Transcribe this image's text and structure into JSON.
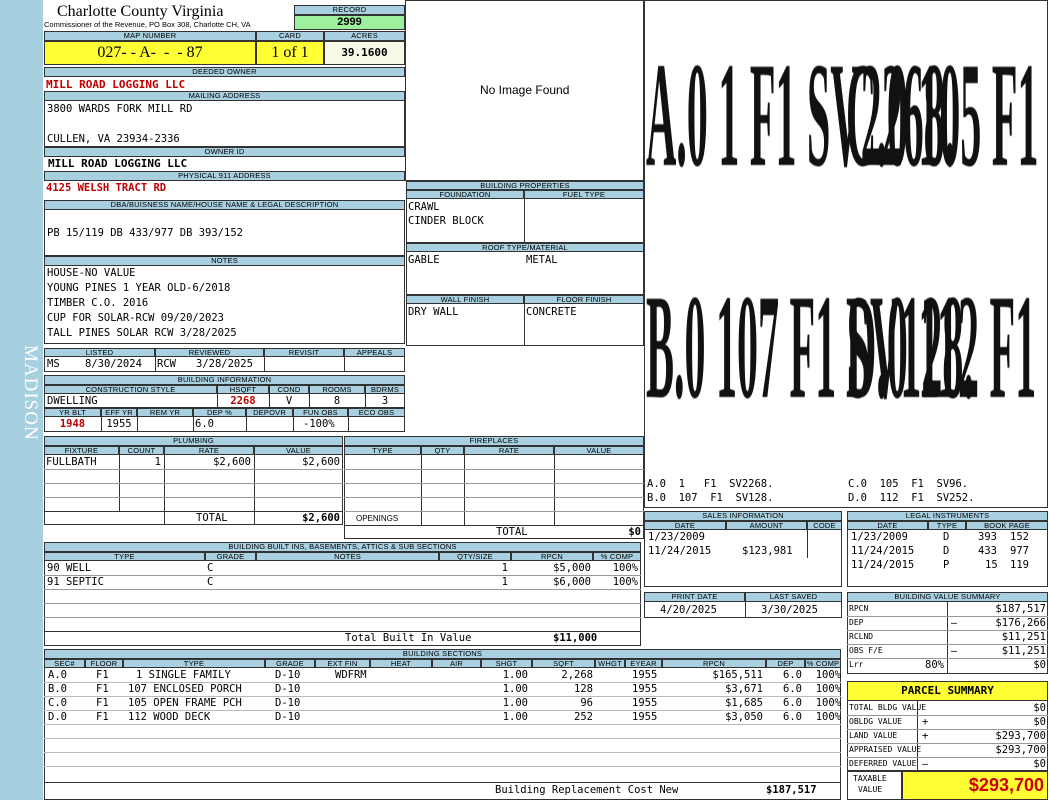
{
  "county": {
    "title": "Charlotte County Virginia",
    "subtitle": "Commissioner of the Revenue, PO Box 308, Charlotte CH, VA"
  },
  "side_label": "MADISON",
  "record": {
    "label": "RECORD",
    "value": "2999"
  },
  "map": {
    "label": "MAP NUMBER",
    "value": "027- - A-  -  - 87"
  },
  "card": {
    "label": "CARD",
    "value": "1 of 1"
  },
  "acres": {
    "label": "ACRES",
    "value": "39.1600"
  },
  "deeded_owner": {
    "label": "DEEDED OWNER",
    "value": "MILL ROAD LOGGING LLC"
  },
  "mailing": {
    "label": "MAILING ADDRESS",
    "line1": "3800 WARDS FORK MILL RD",
    "line2": "CULLEN, VA 23934-2336"
  },
  "owner_id": {
    "label": "OWNER ID",
    "value": "MILL ROAD LOGGING LLC"
  },
  "physical": {
    "label": "PHYSICAL 911 ADDRESS",
    "value": "4125 WELSH TRACT RD"
  },
  "dba": {
    "label": "DBA/BUISNESS NAME/HOUSE NAME & LEGAL DESCRIPTION",
    "value": "PB 15/119 DB 433/977 DB 393/152"
  },
  "notes": {
    "label": "NOTES",
    "lines": [
      "HOUSE-NO VALUE",
      "YOUNG PINES 1 YEAR OLD-6/2018",
      "TIMBER C.O. 2016",
      "CUP FOR SOLAR-RCW 09/20/2023",
      "TALL PINES SOLAR RCW 3/28/2025"
    ]
  },
  "review": {
    "listed_label": "LISTED",
    "reviewed_label": "REVIEWED",
    "revisit_label": "REVISIT",
    "appeals_label": "APPEALS",
    "listed_by": "MS",
    "listed_date": "8/30/2024",
    "reviewed_by": "RCW",
    "reviewed_date": "3/28/2025"
  },
  "building_info": {
    "label": "BUILDING INFORMATION",
    "construction_style_label": "CONSTRUCTION STYLE",
    "hsqft_label": "HSQFT",
    "cond_label": "COND",
    "rooms_label": "ROOMS",
    "bdrms_label": "BDRMS",
    "construction_style": "DWELLING",
    "hsqft": "2268",
    "cond": "V",
    "rooms": "8",
    "bdrms": "3",
    "yr_blt_label": "YR BLT",
    "eff_yr_label": "EFF YR",
    "rem_yr_label": "REM YR",
    "dep_pct_label": "DEP %",
    "depovr_label": "DEPOVR",
    "fun_obs_label": "FUN OBS",
    "eco_obs_label": "ECO OBS",
    "yr_blt": "1948",
    "eff_yr": "1955",
    "dep_pct": "6.0",
    "fun_obs": "-100%"
  },
  "no_image": "No Image Found",
  "bldg_props": {
    "label": "BUILDING PROPERTIES",
    "foundation_label": "FOUNDATION",
    "fuel_label": "FUEL TYPE",
    "foundation1": "CRAWL",
    "foundation2": "CINDER BLOCK",
    "roof_label": "ROOF TYPE/MATERIAL",
    "roof_type": "GABLE",
    "roof_material": "METAL",
    "wall_label": "WALL FINISH",
    "floor_label": "FLOOR FINISH",
    "wall": "DRY WALL",
    "floor": "CONCRETE"
  },
  "sketch": {
    "labels": [
      {
        "row": "A.0  1   F1  SV2268.",
        "right": "C.0  105  F1  SV96."
      },
      {
        "row": "B.0  107  F1  SV128.",
        "right": "D.0  112  F1  SV252."
      }
    ]
  },
  "plumbing": {
    "label": "PLUMBING",
    "headers": [
      "FIXTURE",
      "COUNT",
      "RATE",
      "VALUE"
    ],
    "rows": [
      {
        "fixture": "FULLBATH",
        "count": "1",
        "rate": "$2,600",
        "value": "$2,600"
      }
    ],
    "total_label": "TOTAL",
    "total": "$2,600"
  },
  "fireplaces": {
    "label": "FIREPLACES",
    "headers": [
      "TYPE",
      "QTY",
      "RATE",
      "VALUE"
    ],
    "openings_label": "OPENINGS",
    "total_label": "TOTAL",
    "total": "$0"
  },
  "sales": {
    "label": "SALES INFORMATION",
    "headers": [
      "DATE",
      "AMOUNT",
      "CODE"
    ],
    "rows": [
      {
        "date": "1/23/2009",
        "amount": "",
        "code": ""
      },
      {
        "date": "11/24/2015",
        "amount": "$123,981",
        "code": ""
      }
    ]
  },
  "legal": {
    "label": "LEGAL INSTRUMENTS",
    "headers": [
      "DATE",
      "TYPE",
      "BOOK PAGE"
    ],
    "rows": [
      {
        "date": "1/23/2009",
        "type": "D",
        "book": "393",
        "page": "152"
      },
      {
        "date": "11/24/2015",
        "type": "D",
        "book": "433",
        "page": "977"
      },
      {
        "date": "11/24/2015",
        "type": "P",
        "book": "15",
        "page": "119"
      }
    ]
  },
  "builtins": {
    "label": "BUILDING BUILT INS, BASEMENTS, ATTICS & SUB SECTIONS",
    "headers": [
      "TYPE",
      "GRADE",
      "NOTES",
      "QTY/SIZE",
      "RPCN",
      "% COMP"
    ],
    "rows": [
      {
        "type": "90 WELL",
        "grade": "C",
        "notes": "",
        "qty": "1",
        "rpcn": "$5,000",
        "comp": "100%"
      },
      {
        "type": "91 SEPTIC",
        "grade": "C",
        "notes": "",
        "qty": "1",
        "rpcn": "$6,000",
        "comp": "100%"
      }
    ],
    "total_label": "Total Built In Value",
    "total": "$11,000"
  },
  "print": {
    "print_label": "PRINT DATE",
    "saved_label": "LAST SAVED",
    "print_date": "4/20/2025",
    "saved_date": "3/30/2025"
  },
  "value_summary": {
    "label": "BUILDING VALUE SUMMARY",
    "rows": [
      {
        "label": "RPCN",
        "sign": "",
        "value": "$187,517"
      },
      {
        "label": "DEP",
        "sign": "–",
        "value": "$176,266"
      },
      {
        "label": "RCLND",
        "sign": "",
        "value": "$11,251"
      },
      {
        "label": "OBS F/E",
        "sign": "–",
        "value": "$11,251"
      },
      {
        "label": "Lrr",
        "sign": "80%",
        "value": "$0"
      }
    ]
  },
  "sections": {
    "label": "BUILDING SECTIONS",
    "headers": [
      "SEC#",
      "FLOOR",
      "TYPE",
      "GRADE",
      "EXT FIN",
      "HEAT",
      "AIR",
      "SHGT",
      "SQFT",
      "WHGT",
      "EYEAR",
      "RPCN",
      "DEP",
      "% COMP"
    ],
    "rows": [
      {
        "sec": "A.0",
        "floor": "F1",
        "type": "1 SINGLE FAMILY",
        "grade": "D-10",
        "ext": "WDFRM",
        "shgt": "1.00",
        "sqft": "2,268",
        "eyear": "1955",
        "rpcn": "$165,511",
        "dep": "6.0",
        "comp": "100%"
      },
      {
        "sec": "B.0",
        "floor": "F1",
        "type": "107 ENCLOSED PORCH",
        "grade": "D-10",
        "ext": "",
        "shgt": "1.00",
        "sqft": "128",
        "eyear": "1955",
        "rpcn": "$3,671",
        "dep": "6.0",
        "comp": "100%"
      },
      {
        "sec": "C.0",
        "floor": "F1",
        "type": "105 OPEN FRAME PCH",
        "grade": "D-10",
        "ext": "",
        "shgt": "1.00",
        "sqft": "96",
        "eyear": "1955",
        "rpcn": "$1,685",
        "dep": "6.0",
        "comp": "100%"
      },
      {
        "sec": "D.0",
        "floor": "F1",
        "type": "112 WOOD DECK",
        "grade": "D-10",
        "ext": "",
        "shgt": "1.00",
        "sqft": "252",
        "eyear": "1955",
        "rpcn": "$3,050",
        "dep": "6.0",
        "comp": "100%"
      }
    ],
    "total_label": "Building Replacement Cost New",
    "total": "$187,517"
  },
  "parcel": {
    "label": "PARCEL SUMMARY",
    "rows": [
      {
        "label": "TOTAL BLDG VALUE",
        "sign": "",
        "value": "$0"
      },
      {
        "label": "OBLDG VALUE",
        "sign": "+",
        "value": "$0"
      },
      {
        "label": "LAND VALUE",
        "sign": "+",
        "value": "$293,700"
      },
      {
        "label": "APPRAISED VALUE",
        "sign": "",
        "value": "$293,700"
      },
      {
        "label": "DEFERRED VALUE",
        "sign": "–",
        "value": "$0"
      }
    ],
    "taxable_label1": "TAXABLE",
    "taxable_label2": "VALUE",
    "taxable": "$293,700"
  }
}
